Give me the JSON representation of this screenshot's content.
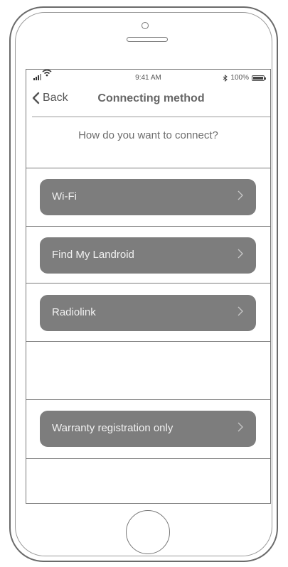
{
  "status_bar": {
    "time": "9:41 AM",
    "battery": "100%",
    "battery_level": 1.0,
    "icons": [
      "signal-icon",
      "wifi-icon",
      "bluetooth-icon",
      "battery-icon"
    ]
  },
  "nav": {
    "back_label": "Back",
    "title": "Connecting method"
  },
  "prompt": "How do you want to connect?",
  "options": [
    {
      "label": "Wi-Fi"
    },
    {
      "label": "Find My Landroid"
    },
    {
      "label": "Radiolink"
    },
    {
      "label": "Warranty registration only"
    }
  ],
  "colors": {
    "button_bg": "#7d7d7d",
    "button_text": "#f1f1f1",
    "text_gray": "#6d6d6d"
  }
}
